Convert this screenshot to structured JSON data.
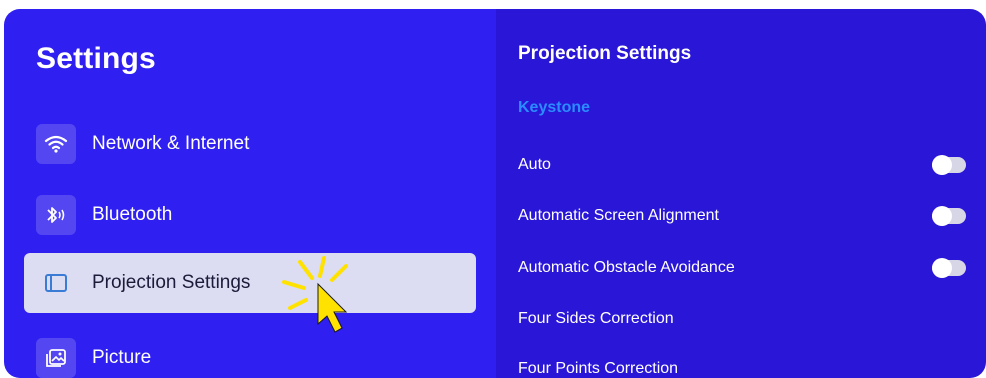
{
  "settings": {
    "title": "Settings",
    "menu": [
      {
        "label": "Network & Internet",
        "icon": "wifi-icon",
        "selected": false
      },
      {
        "label": "Bluetooth",
        "icon": "bluetooth-icon",
        "selected": false
      },
      {
        "label": "Projection Settings",
        "icon": "projection-icon",
        "selected": true
      },
      {
        "label": "Picture",
        "icon": "picture-icon",
        "selected": false
      }
    ]
  },
  "projection": {
    "title": "Projection Settings",
    "section": "Keystone",
    "rows": [
      {
        "label": "Auto",
        "toggle": true,
        "on": false
      },
      {
        "label": "Automatic Screen Alignment",
        "toggle": true,
        "on": false
      },
      {
        "label": "Automatic Obstacle Avoidance",
        "toggle": true,
        "on": false
      },
      {
        "label": "Four Sides Correction",
        "toggle": false
      },
      {
        "label": "Four Points Correction",
        "toggle": false
      }
    ]
  },
  "colors": {
    "left_bg": "#2f1ff0",
    "right_bg": "#2a16d6",
    "section_accent": "#2a8cff",
    "selected_bg": "#dcdcf2",
    "cursor": "#ffe200"
  }
}
